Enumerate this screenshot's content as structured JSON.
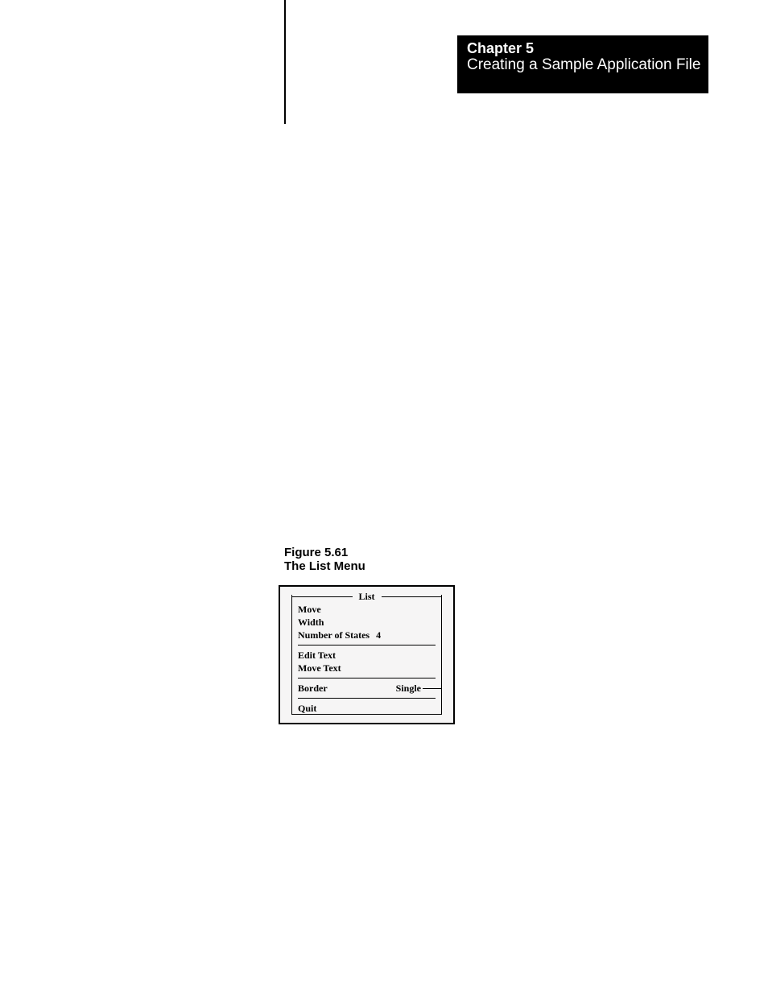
{
  "header": {
    "chapter_number": "Chapter 5",
    "chapter_title": "Creating a Sample Application File"
  },
  "figure": {
    "caption_number": "Figure 5.61",
    "caption_title": "The List Menu"
  },
  "menu": {
    "title": "List",
    "items": {
      "move": "Move",
      "width": "Width",
      "num_states_label": "Number of States",
      "num_states_value": "4",
      "edit_text": "Edit Text",
      "move_text": "Move Text",
      "border_label": "Border",
      "border_value": "Single",
      "quit": "Quit"
    }
  }
}
